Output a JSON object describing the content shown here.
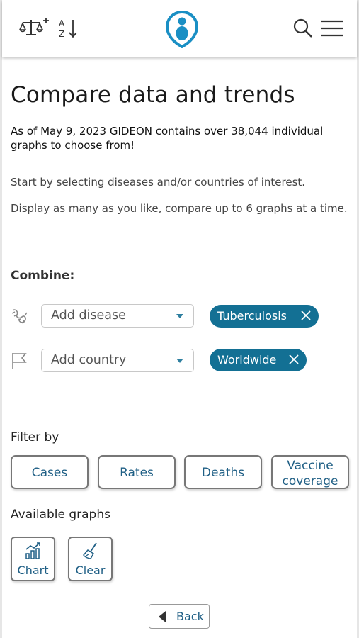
{
  "header": {
    "icons": [
      "scale-plus-icon",
      "sort-az-icon",
      "gideon-logo",
      "search-icon",
      "menu-icon"
    ],
    "sort_letters": [
      "A",
      "Z"
    ]
  },
  "main": {
    "title": "Compare data and trends",
    "subtitle": "As of May 9, 2023 GIDEON contains over 38,044 individual graphs to choose from!",
    "paragraph1": "Start by selecting diseases and/or countries of interest.",
    "paragraph2": "Display as many as you like, compare up to 6 graphs at a time."
  },
  "combine": {
    "label": "Combine:",
    "disease": {
      "placeholder": "Add disease",
      "tags": [
        "Tuberculosis"
      ]
    },
    "country": {
      "placeholder": "Add country",
      "tags": [
        "Worldwide"
      ]
    }
  },
  "filter": {
    "label": "Filter by",
    "buttons": [
      "Cases",
      "Rates",
      "Deaths",
      "Vaccine coverage"
    ]
  },
  "graphs": {
    "label": "Available graphs",
    "buttons": [
      "Chart",
      "Clear"
    ]
  },
  "footer": {
    "back_label": "Back"
  },
  "colors": {
    "accent": "#137094",
    "button_text": "#1f5f85",
    "logo": "#1a8fc4"
  }
}
